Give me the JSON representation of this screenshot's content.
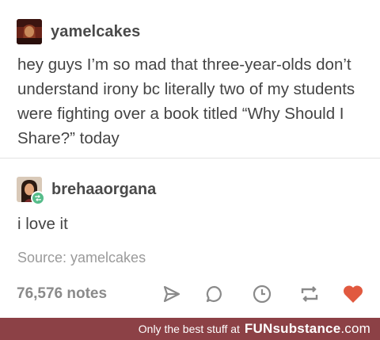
{
  "post": {
    "username": "yamelcakes",
    "body": "hey guys I’m so mad that three-year-olds don’t understand irony bc literally two of my students were fighting over a book titled “Why Should I Share?” today"
  },
  "reblog": {
    "username": "brehaaorgana",
    "body": "i love it"
  },
  "source": "Source: yamelcakes",
  "footer": {
    "notes": "76,576 notes",
    "icons": [
      "share-icon",
      "reply-icon",
      "clock-icon",
      "reblog-icon",
      "heart-icon"
    ]
  },
  "banner": {
    "text": "Only the best stuff at",
    "brand_a": "FUN",
    "brand_b": "substance",
    "brand_c": ".com"
  },
  "colors": {
    "heart": "#e1593f",
    "reblog_badge": "#56bc8a",
    "banner": "#8c4146"
  }
}
